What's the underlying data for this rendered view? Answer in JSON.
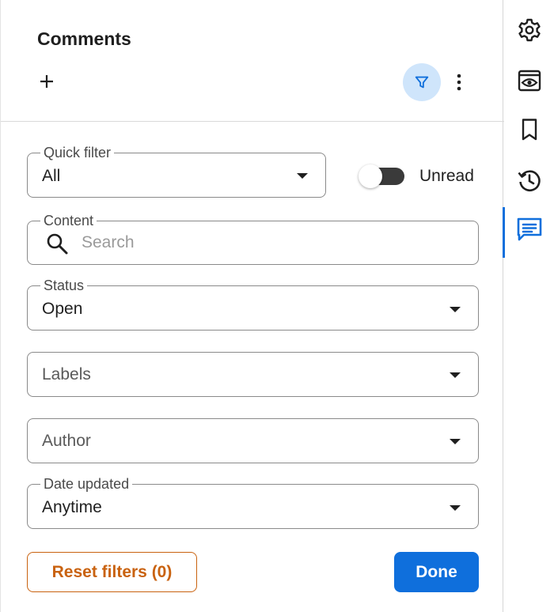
{
  "panel": {
    "title": "Comments",
    "actions": {
      "add_icon": "plus-icon",
      "filter_icon": "filter-icon",
      "more_icon": "more-vertical-icon"
    }
  },
  "filters": {
    "quick_filter": {
      "label": "Quick filter",
      "value": "All"
    },
    "unread_toggle": {
      "label": "Unread",
      "on": false
    },
    "content": {
      "label": "Content",
      "placeholder": "Search",
      "value": ""
    },
    "status": {
      "label": "Status",
      "value": "Open"
    },
    "labels": {
      "placeholder": "Labels"
    },
    "author": {
      "placeholder": "Author"
    },
    "date_updated": {
      "label": "Date updated",
      "value": "Anytime"
    }
  },
  "footer": {
    "reset_label": "Reset filters (0)",
    "done_label": "Done"
  },
  "rail": {
    "items": [
      {
        "icon": "gear-icon",
        "active": false
      },
      {
        "icon": "eye-preview-icon",
        "active": false
      },
      {
        "icon": "bookmark-icon",
        "active": false
      },
      {
        "icon": "history-icon",
        "active": false
      },
      {
        "icon": "comment-icon",
        "active": true
      }
    ]
  },
  "colors": {
    "accent": "#0f6fdc",
    "filter_active_bg": "#cfe5fb",
    "reset": "#c9620f"
  }
}
